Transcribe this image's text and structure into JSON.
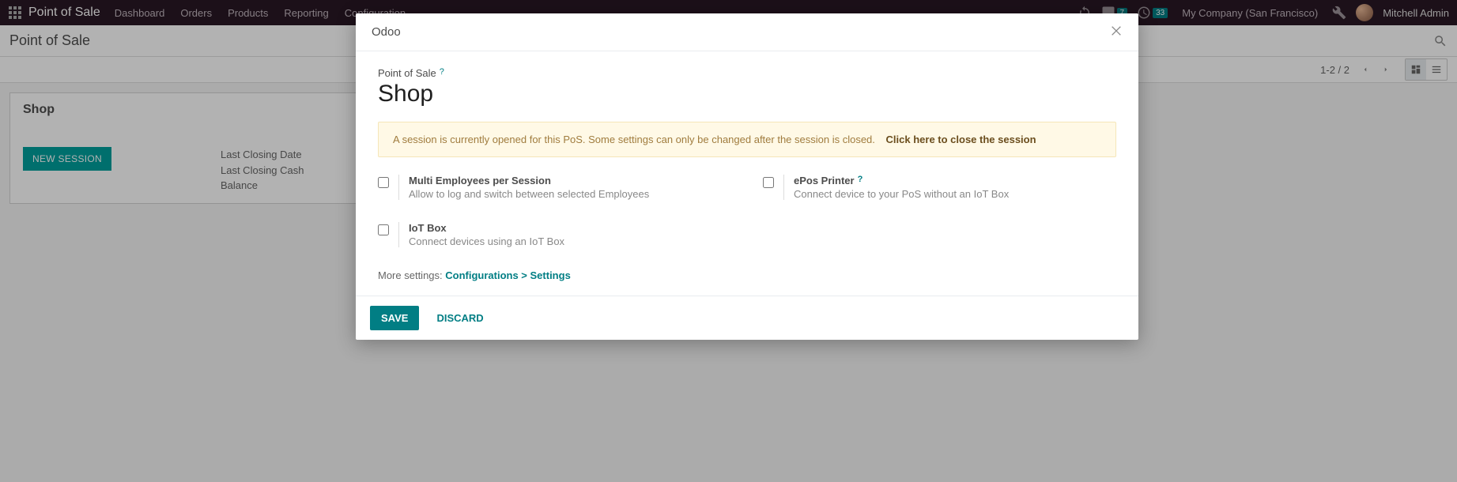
{
  "topnav": {
    "app_title": "Point of Sale",
    "menu": [
      "Dashboard",
      "Orders",
      "Products",
      "Reporting",
      "Configuration"
    ],
    "discuss_badge": "7",
    "activity_badge": "33",
    "company": "My Company (San Francisco)",
    "user": "Mitchell Admin"
  },
  "breadcrumb": {
    "title": "Point of Sale"
  },
  "pager": {
    "text": "1-2 / 2"
  },
  "kanban": {
    "card_title": "Shop",
    "new_session": "NEW SESSION",
    "last_closing_date": "Last Closing Date",
    "last_closing_cash": "Last Closing Cash",
    "balance": "Balance"
  },
  "modal": {
    "header_title": "Odoo",
    "breadcrumb_label": "Point of Sale",
    "record_title": "Shop",
    "alert": {
      "text": "A session is currently opened for this PoS. Some settings can only be changed after the session is closed.",
      "link": "Click here to close the session"
    },
    "settings": {
      "multi_emp": {
        "title": "Multi Employees per Session",
        "desc": "Allow to log and switch between selected Employees"
      },
      "epos": {
        "title": "ePos Printer",
        "desc": "Connect device to your PoS without an IoT Box"
      },
      "iot": {
        "title": "IoT Box",
        "desc": "Connect devices using an IoT Box"
      }
    },
    "more_label": "More settings: ",
    "more_link": "Configurations > Settings",
    "save": "SAVE",
    "discard": "DISCARD"
  }
}
